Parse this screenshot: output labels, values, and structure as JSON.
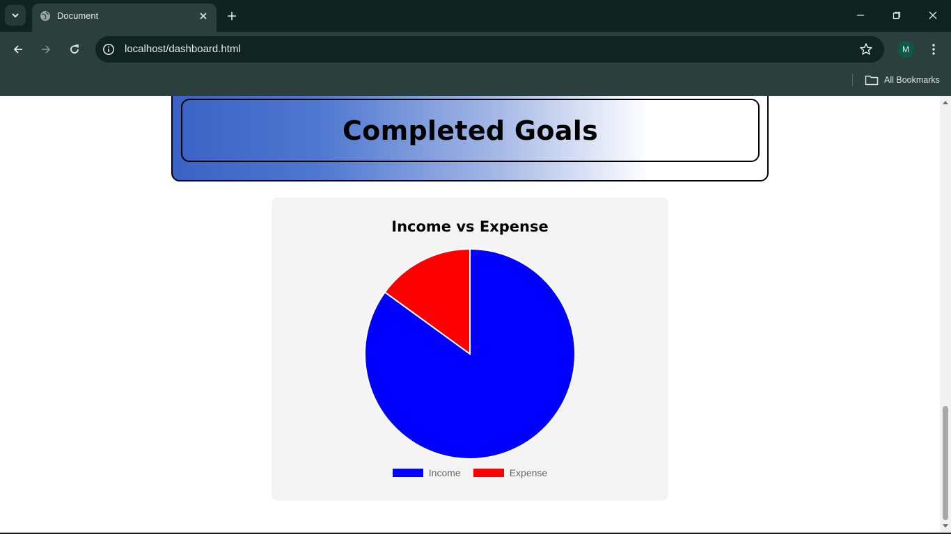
{
  "browser": {
    "tab_title": "Document",
    "url": "localhost/dashboard.html",
    "profile_initial": "M",
    "bookmarks_label": "All Bookmarks"
  },
  "page": {
    "goals_heading": "Completed Goals",
    "chart_title": "Income vs Expense"
  },
  "chart_data": {
    "type": "pie",
    "title": "Income vs Expense",
    "categories": [
      "Income",
      "Expense"
    ],
    "values": [
      85,
      15
    ],
    "colors": [
      "#0000ff",
      "#ff0000"
    ],
    "legend_position": "bottom"
  },
  "icons": {
    "tab_search": "chevron-down-icon",
    "favicon": "globe-icon",
    "close": "close-icon",
    "new_tab": "plus-icon",
    "back": "arrow-left-icon",
    "forward": "arrow-right-icon",
    "reload": "reload-icon",
    "site_info": "info-icon",
    "bookmark": "star-icon",
    "menu": "kebab-icon",
    "folder": "folder-icon"
  }
}
